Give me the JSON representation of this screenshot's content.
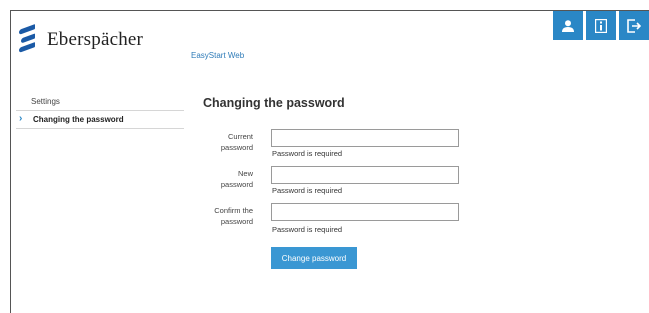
{
  "brand": {
    "name": "Eberspächer",
    "color": "#1b5aa6"
  },
  "header": {
    "app_link": "EasyStart Web"
  },
  "toolbar": {
    "buttons": [
      {
        "icon": "user-icon"
      },
      {
        "icon": "info-icon"
      },
      {
        "icon": "logout-icon"
      }
    ],
    "accent": "#2a87c6"
  },
  "sidebar": {
    "items": [
      {
        "label": "Settings",
        "active": false
      },
      {
        "label": "Changing the password",
        "active": true
      }
    ]
  },
  "main": {
    "title": "Changing the password",
    "fields": [
      {
        "label": "Current password",
        "value": "",
        "error": "Password is required"
      },
      {
        "label": "New password",
        "value": "",
        "error": "Password is required"
      },
      {
        "label": "Confirm the password",
        "value": "",
        "error": "Password is required"
      }
    ],
    "submit_label": "Change password"
  }
}
